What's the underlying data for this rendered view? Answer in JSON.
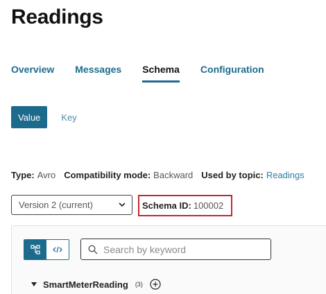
{
  "page": {
    "title": "Readings"
  },
  "tabs": [
    {
      "label": "Overview",
      "active": false
    },
    {
      "label": "Messages",
      "active": false
    },
    {
      "label": "Schema",
      "active": true
    },
    {
      "label": "Configuration",
      "active": false
    }
  ],
  "format_toggle": {
    "value_label": "Value",
    "key_label": "Key",
    "selected": "Value"
  },
  "meta": {
    "type_label": "Type:",
    "type_value": "Avro",
    "compat_label": "Compatibility mode:",
    "compat_value": "Backward",
    "used_label": "Used by topic:",
    "used_value": "Readings"
  },
  "version_select": {
    "value": "Version 2 (current)",
    "icon": "chevron-down-icon"
  },
  "schema_id": {
    "label": "Schema ID:",
    "value": "100002",
    "highlight_color": "#c1272d"
  },
  "schema_view": {
    "tree_view_icon": "tree-view-icon",
    "code_view_icon": "code-view-icon",
    "search": {
      "placeholder": "Search by keyword",
      "value": "",
      "icon": "search-icon"
    },
    "root": {
      "name": "SmartMeterReading",
      "count": "(3)",
      "expanded": true,
      "add_icon": "add-circle-icon"
    }
  },
  "colors": {
    "accent": "#1d6b8c",
    "link": "#2a7fa5"
  }
}
